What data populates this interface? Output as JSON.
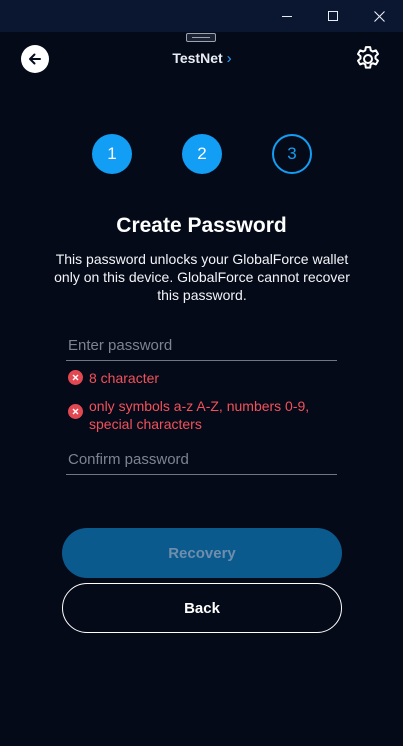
{
  "window": {
    "controls": [
      "minimize-icon",
      "maximize-icon",
      "close-icon"
    ]
  },
  "header": {
    "back_icon": "arrow-left-icon",
    "network_label": "TestNet",
    "network_chevron": "›",
    "settings_icon": "gear-icon"
  },
  "steps": [
    {
      "label": "1",
      "state": "done"
    },
    {
      "label": "2",
      "state": "done"
    },
    {
      "label": "3",
      "state": "current"
    }
  ],
  "form": {
    "title": "Create Password",
    "description": "This password unlocks your GlobalForce wallet only on this device. GlobalForce cannot recover this password.",
    "password_placeholder": "Enter password",
    "password_value": "",
    "errors": [
      "8 character",
      "only symbols a-z A-Z, numbers 0-9, special characters"
    ],
    "confirm_placeholder": "Confirm password",
    "confirm_value": ""
  },
  "buttons": {
    "recovery_label": "Recovery",
    "back_label": "Back"
  },
  "colors": {
    "background": "#050a18",
    "titlebar": "#0b1631",
    "accent": "#139ef5",
    "error": "#f2515b",
    "disabled_button": "#0b5a8e"
  }
}
